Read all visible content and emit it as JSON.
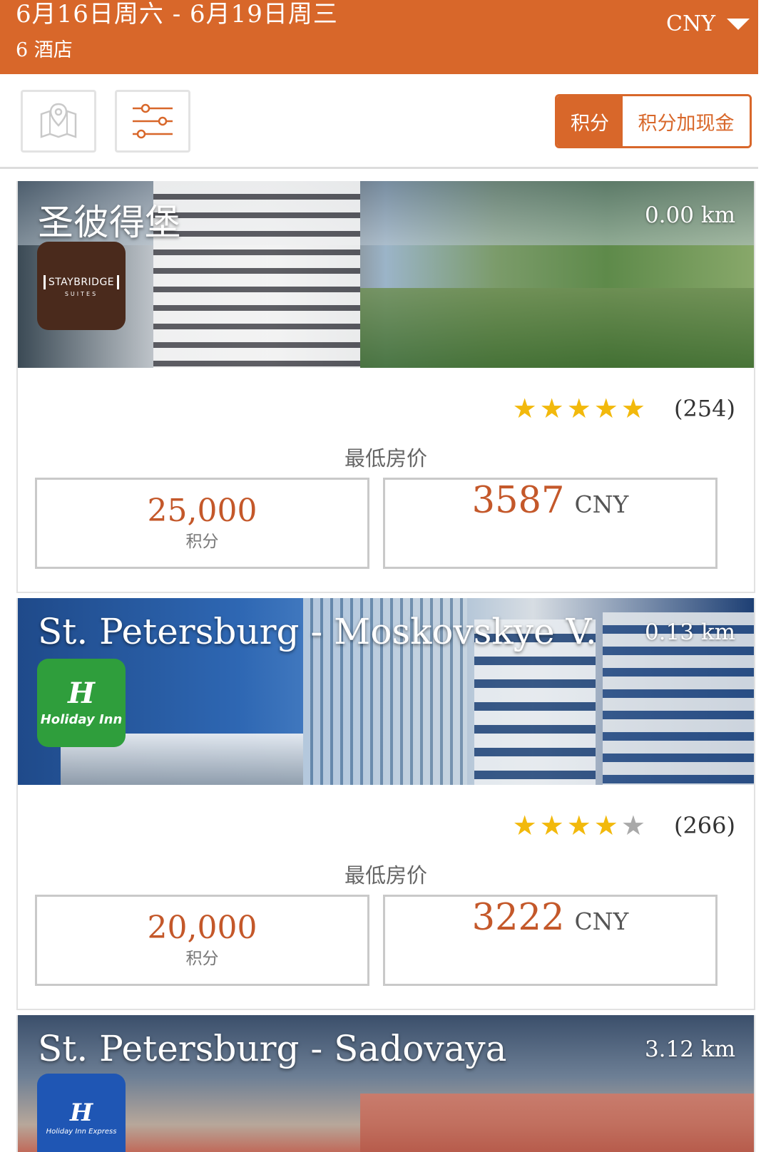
{
  "header": {
    "dates": "6月16日周六 - 6月19日周三",
    "hotel_count": "6 酒店",
    "currency": "CNY"
  },
  "toolbar": {
    "map_icon": "map-pin-icon",
    "filter_icon": "sliders-icon",
    "toggle_points": "积分",
    "toggle_points_cash": "积分加现金"
  },
  "colors": {
    "brand": "#d8672a",
    "price": "#c4582a",
    "star": "#f2b90c"
  },
  "hotels": [
    {
      "name": "圣彼得堡",
      "distance": "0.00 km",
      "brand_logo_text": "STAYBRIDGE",
      "brand_logo_sub": "SUITES",
      "brand_color": "#4a2a1c",
      "stars": 5,
      "reviews": "(254)",
      "lowest_label": "最低房价",
      "points_value": "25,000",
      "points_label": "积分",
      "cash_value": "3587",
      "cash_currency": "CNY"
    },
    {
      "name": "St. Petersburg - Moskovskye V.",
      "distance": "0.13 km",
      "brand_logo_text": "Holiday Inn",
      "brand_color": "#2f9e3c",
      "stars": 4,
      "reviews": "(266)",
      "lowest_label": "最低房价",
      "points_value": "20,000",
      "points_label": "积分",
      "cash_value": "3222",
      "cash_currency": "CNY"
    },
    {
      "name": "St. Petersburg - Sadovaya",
      "distance": "3.12 km",
      "brand_logo_text": "Holiday Inn Express",
      "brand_color": "#1f56b4"
    }
  ]
}
